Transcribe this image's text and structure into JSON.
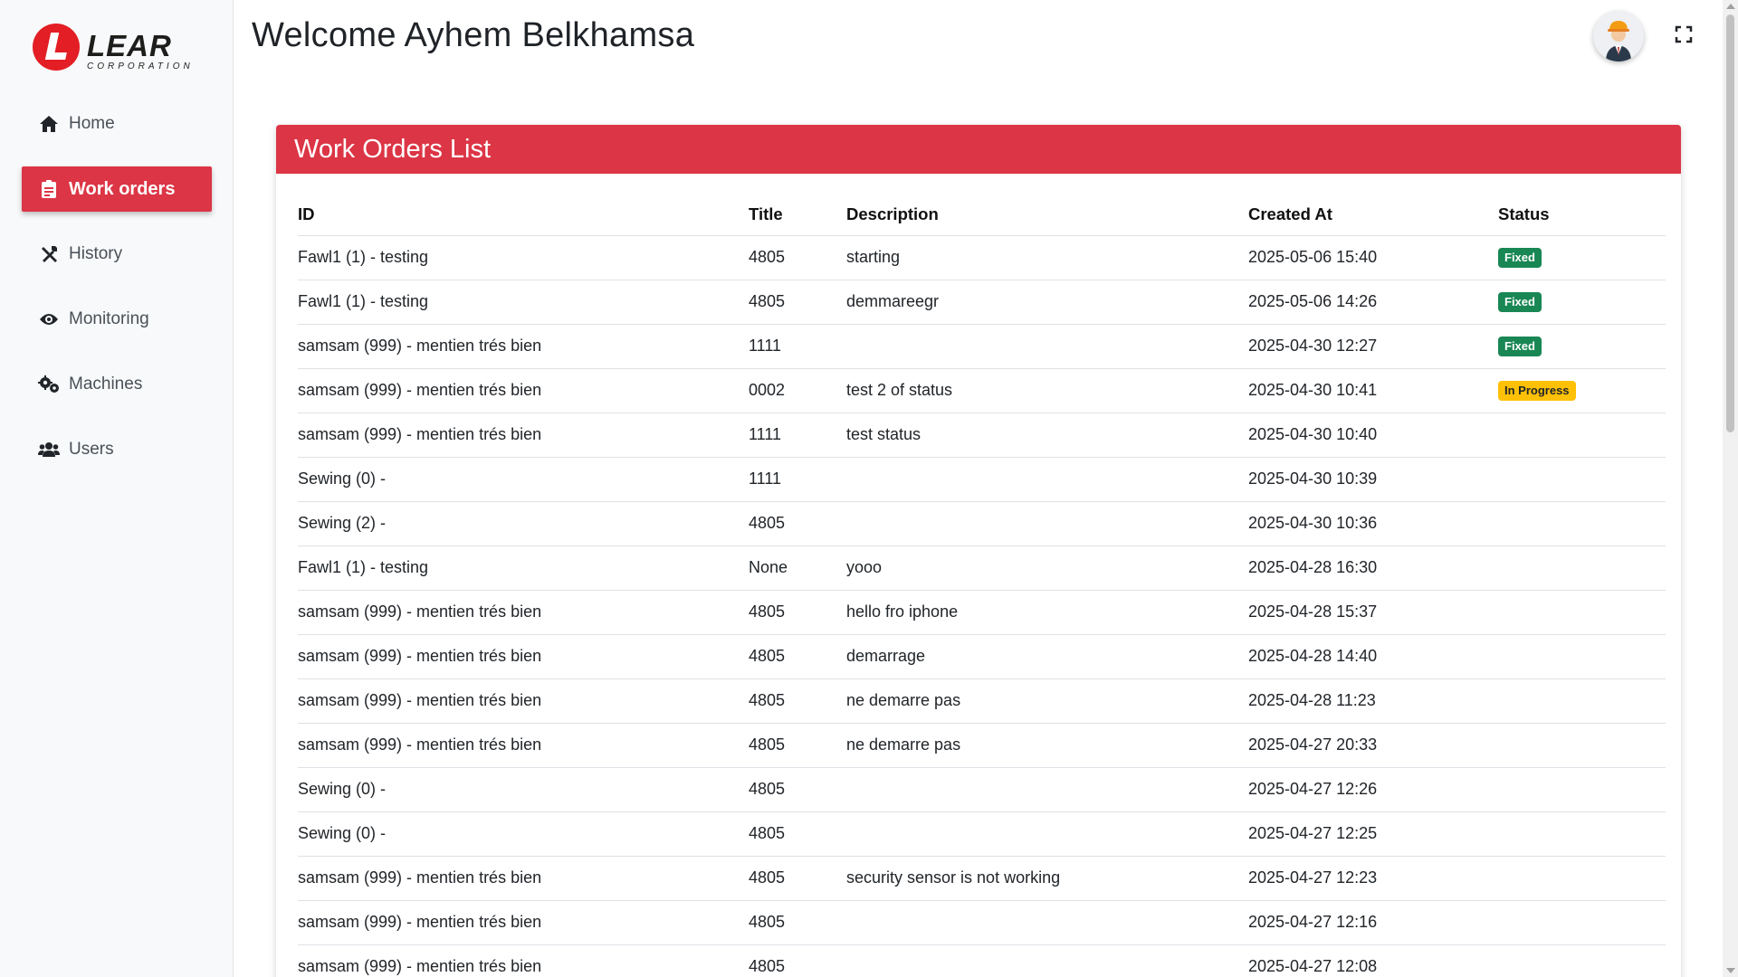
{
  "brand": {
    "word": "LEAR",
    "sub": "CORPORATION",
    "accent": "#e31e24"
  },
  "header": {
    "welcome": "Welcome Ayhem Belkhamsa"
  },
  "sidebar": {
    "items": [
      {
        "label": "Home",
        "icon": "home-icon",
        "active": false
      },
      {
        "label": "Work orders",
        "icon": "clipboard-icon",
        "active": true
      },
      {
        "label": "History",
        "icon": "tools-icon",
        "active": false
      },
      {
        "label": "Monitoring",
        "icon": "eye-icon",
        "active": false
      },
      {
        "label": "Machines",
        "icon": "gears-icon",
        "active": false
      },
      {
        "label": "Users",
        "icon": "users-icon",
        "active": false
      }
    ]
  },
  "card": {
    "title": "Work Orders List",
    "color": "#dc3545"
  },
  "table": {
    "headers": {
      "id": "ID",
      "title": "Title",
      "description": "Description",
      "created": "Created At",
      "status": "Status"
    },
    "rows": [
      {
        "id": "Fawl1 (1) - testing",
        "title": "4805",
        "description": "starting",
        "created": "2025-05-06 15:40",
        "status": "Fixed"
      },
      {
        "id": "Fawl1 (1) - testing",
        "title": "4805",
        "description": "demmareegr",
        "created": "2025-05-06 14:26",
        "status": "Fixed"
      },
      {
        "id": "samsam (999) - mentien trés bien",
        "title": "1111",
        "description": "",
        "created": "2025-04-30 12:27",
        "status": "Fixed"
      },
      {
        "id": "samsam (999) - mentien trés bien",
        "title": "0002",
        "description": "test 2 of status",
        "created": "2025-04-30 10:41",
        "status": "In Progress"
      },
      {
        "id": "samsam (999) - mentien trés bien",
        "title": "1111",
        "description": "test status",
        "created": "2025-04-30 10:40",
        "status": ""
      },
      {
        "id": "Sewing (0) -",
        "title": "1111",
        "description": "",
        "created": "2025-04-30 10:39",
        "status": ""
      },
      {
        "id": "Sewing (2) -",
        "title": "4805",
        "description": "",
        "created": "2025-04-30 10:36",
        "status": ""
      },
      {
        "id": "Fawl1 (1) - testing",
        "title": "None",
        "description": "yooo",
        "created": "2025-04-28 16:30",
        "status": ""
      },
      {
        "id": "samsam (999) - mentien trés bien",
        "title": "4805",
        "description": "hello fro iphone",
        "created": "2025-04-28 15:37",
        "status": ""
      },
      {
        "id": "samsam (999) - mentien trés bien",
        "title": "4805",
        "description": "demarrage",
        "created": "2025-04-28 14:40",
        "status": ""
      },
      {
        "id": "samsam (999) - mentien trés bien",
        "title": "4805",
        "description": "ne demarre pas",
        "created": "2025-04-28 11:23",
        "status": ""
      },
      {
        "id": "samsam (999) - mentien trés bien",
        "title": "4805",
        "description": "ne demarre pas",
        "created": "2025-04-27 20:33",
        "status": ""
      },
      {
        "id": "Sewing (0) -",
        "title": "4805",
        "description": "",
        "created": "2025-04-27 12:26",
        "status": ""
      },
      {
        "id": "Sewing (0) -",
        "title": "4805",
        "description": "",
        "created": "2025-04-27 12:25",
        "status": ""
      },
      {
        "id": "samsam (999) - mentien trés bien",
        "title": "4805",
        "description": "security sensor is not working",
        "created": "2025-04-27 12:23",
        "status": ""
      },
      {
        "id": "samsam (999) - mentien trés bien",
        "title": "4805",
        "description": "",
        "created": "2025-04-27 12:16",
        "status": ""
      },
      {
        "id": "samsam (999) - mentien trés bien",
        "title": "4805",
        "description": "",
        "created": "2025-04-27 12:08",
        "status": ""
      }
    ]
  },
  "status_colors": {
    "Fixed": "#198754",
    "In Progress": "#ffc107"
  }
}
